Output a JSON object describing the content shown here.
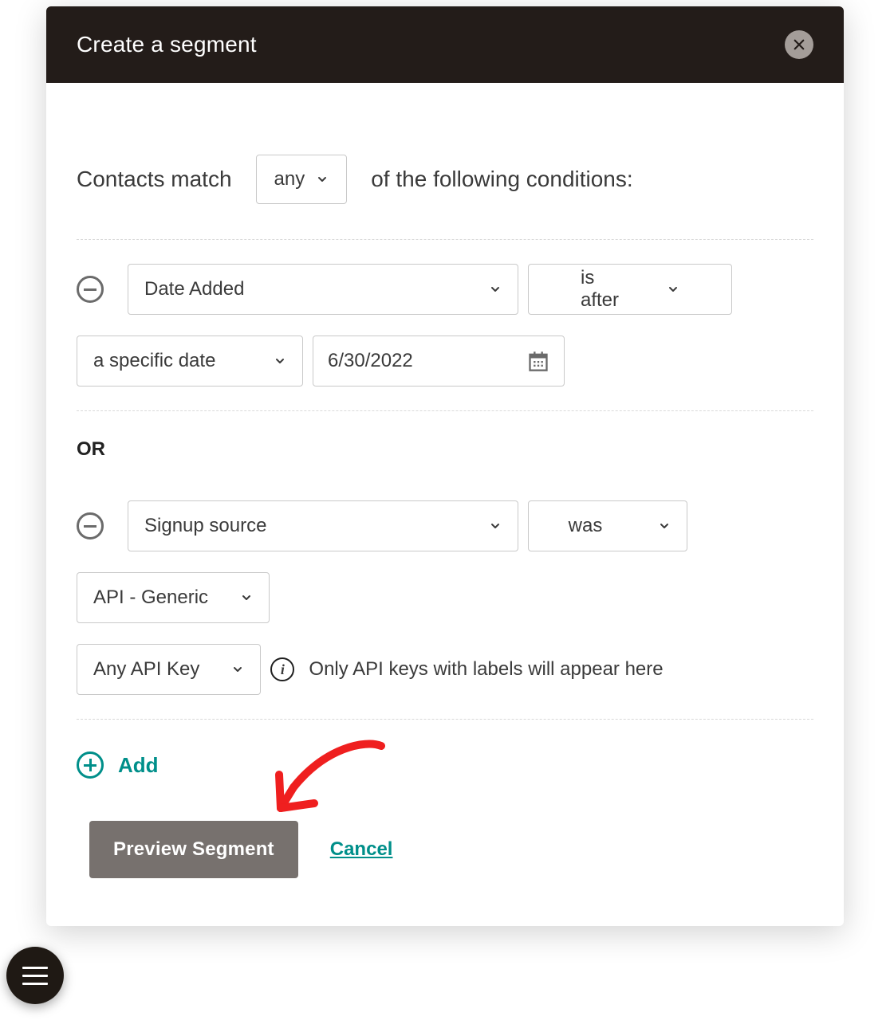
{
  "header": {
    "title": "Create a segment"
  },
  "match": {
    "prefix": "Contacts match",
    "mode": "any",
    "suffix": "of the following conditions:"
  },
  "conditions": [
    {
      "field": "Date Added",
      "operator": "is after",
      "date_mode": "a specific date",
      "date_value": "6/30/2022"
    },
    {
      "field": "Signup source",
      "operator": "was",
      "value1": "API - Generic",
      "value2": "Any API Key",
      "hint": "Only API keys with labels will appear here"
    }
  ],
  "separator": "OR",
  "add_label": "Add",
  "actions": {
    "preview": "Preview Segment",
    "cancel": "Cancel"
  }
}
